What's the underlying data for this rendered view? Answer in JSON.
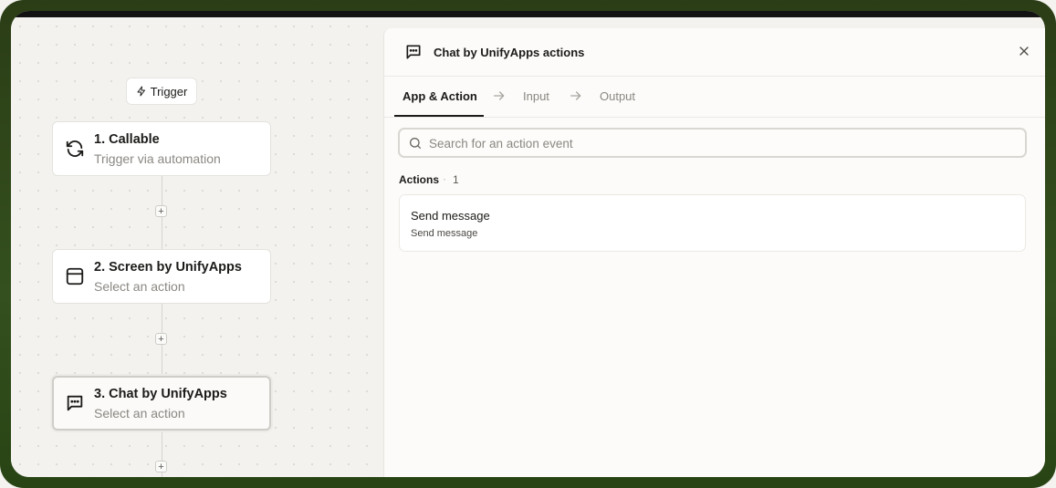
{
  "canvas": {
    "trigger_label": "Trigger",
    "nodes": [
      {
        "title": "1. Callable",
        "subtitle": "Trigger via automation",
        "icon": "refresh-icon"
      },
      {
        "title": "2. Screen by UnifyApps",
        "subtitle": "Select an action",
        "icon": "window-icon"
      },
      {
        "title": "3. Chat by UnifyApps",
        "subtitle": "Select an action",
        "icon": "chat-icon"
      }
    ],
    "add_step_symbol": "+"
  },
  "panel": {
    "title": "Chat by UnifyApps actions",
    "icon": "chat-icon",
    "steps": [
      "App & Action",
      "Input",
      "Output"
    ],
    "search": {
      "placeholder": "Search for an action event",
      "value": ""
    },
    "actions_label": "Actions",
    "actions_separator": "·",
    "actions_count": "1",
    "actions": [
      {
        "title": "Send message",
        "subtitle": "Send message"
      }
    ]
  },
  "colors": {
    "frame": "#2f4a1a",
    "accent": "#1c1b19",
    "muted": "#8a8883"
  }
}
